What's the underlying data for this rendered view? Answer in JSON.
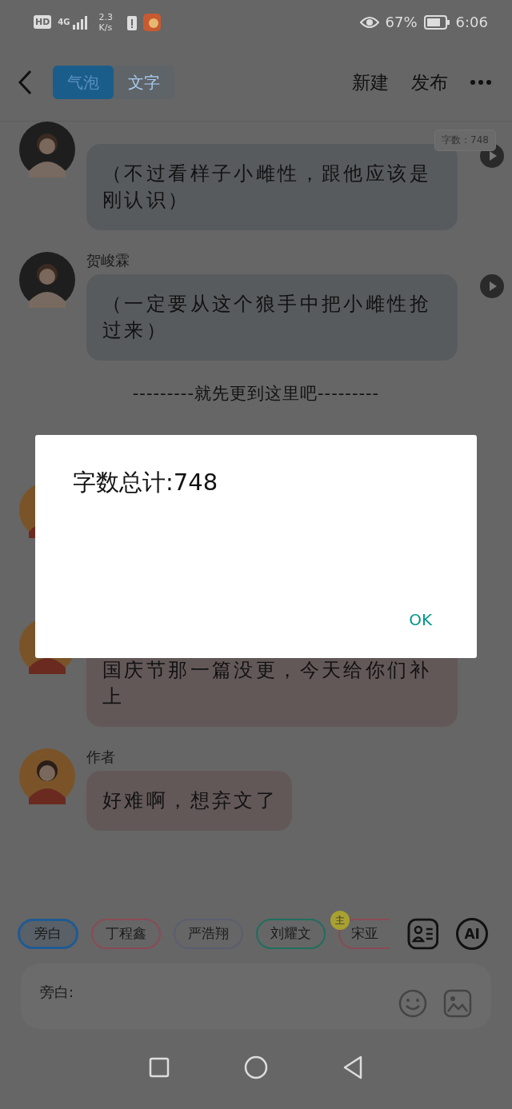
{
  "status_bar": {
    "hd": "HD",
    "network": "4G",
    "speed": "2.3",
    "speed_unit": "K/s",
    "battery": "67%",
    "time": "6:06"
  },
  "header": {
    "tabs": [
      {
        "label": "气泡",
        "selected": true
      },
      {
        "label": "文字",
        "selected": false
      }
    ],
    "actions": [
      "新建",
      "发布"
    ]
  },
  "word_count_badge": "字数：748",
  "messages": [
    {
      "kind": "message",
      "text": "（不过看样子小雌性，跟他应该是刚认识）",
      "color": "#585b5e",
      "play": true
    },
    {
      "kind": "message",
      "name": "贺峻霖",
      "text": "（一定要从这个狼手中把小雌性抢过来）",
      "color": "#585b5e",
      "play": true
    },
    {
      "kind": "divider",
      "text": "---------就先更到这里吧---------"
    },
    {
      "kind": "message"
    },
    {
      "kind": "message",
      "text": "国庆节那一篇没更，今天给你们补上",
      "color": "#635858",
      "play": false
    },
    {
      "kind": "message",
      "name": "作者",
      "text": "好难啊，想弃文了",
      "color": "#635858",
      "play": false
    }
  ],
  "dialog": {
    "title": "字数总计:748",
    "button": "OK"
  },
  "role_chips": [
    {
      "label": "旁白",
      "color": "#1f5a93",
      "selected": true
    },
    {
      "label": "丁程鑫",
      "color": "#8a4a55",
      "selected": false
    },
    {
      "label": "严浩翔",
      "color": "#5a5e70",
      "selected": false
    },
    {
      "label": "刘耀文",
      "color": "#1f6e5e",
      "selected": false
    },
    {
      "label": "宋亚",
      "color": "#8a4a55",
      "selected": false,
      "badge": "主"
    }
  ],
  "ai_button": "AI",
  "input": {
    "label": "旁白:"
  }
}
